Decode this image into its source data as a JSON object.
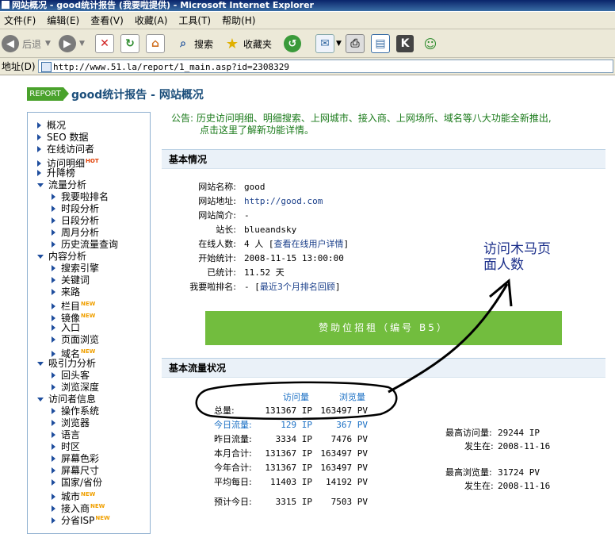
{
  "window": {
    "title": "网站概况 - good统计报告 (我要啦提供) - Microsoft Internet Explorer"
  },
  "menu": [
    "文件(F)",
    "编辑(E)",
    "查看(V)",
    "收藏(A)",
    "工具(T)",
    "帮助(H)"
  ],
  "toolbar": {
    "back_label": "后退",
    "search_label": "搜索",
    "favorites_label": "收藏夹"
  },
  "address": {
    "label": "地址(D)",
    "url": "http://www.51.la/report/1_main.asp?id=2308329"
  },
  "header": {
    "badge": "REPORT",
    "title": "good统计报告 - 网站概况"
  },
  "sidebar": {
    "items": [
      {
        "label": "概况",
        "level": 0,
        "arrow": "right"
      },
      {
        "label": "SEO 数据",
        "level": 0,
        "arrow": "right"
      },
      {
        "label": "在线访问者",
        "level": 0,
        "arrow": "right"
      },
      {
        "label": "访问明细",
        "level": 0,
        "arrow": "right",
        "badge": "HOT"
      },
      {
        "label": "升降榜",
        "level": 0,
        "arrow": "right"
      },
      {
        "label": "流量分析",
        "level": 0,
        "arrow": "down"
      },
      {
        "label": "我要啦排名",
        "level": 1,
        "arrow": "right"
      },
      {
        "label": "时段分析",
        "level": 1,
        "arrow": "right"
      },
      {
        "label": "日段分析",
        "level": 1,
        "arrow": "right"
      },
      {
        "label": "周月分析",
        "level": 1,
        "arrow": "right"
      },
      {
        "label": "历史流量查询",
        "level": 1,
        "arrow": "right"
      },
      {
        "label": "内容分析",
        "level": 0,
        "arrow": "down"
      },
      {
        "label": "搜索引擎",
        "level": 1,
        "arrow": "right"
      },
      {
        "label": "关键词",
        "level": 1,
        "arrow": "right"
      },
      {
        "label": "来路",
        "level": 1,
        "arrow": "right"
      },
      {
        "label": "栏目",
        "level": 1,
        "arrow": "right",
        "badge": "NEW"
      },
      {
        "label": "镜像",
        "level": 1,
        "arrow": "right",
        "badge": "NEW"
      },
      {
        "label": "入口",
        "level": 1,
        "arrow": "right"
      },
      {
        "label": "页面浏览",
        "level": 1,
        "arrow": "right"
      },
      {
        "label": "域名",
        "level": 1,
        "arrow": "right",
        "badge": "NEW"
      },
      {
        "label": "吸引力分析",
        "level": 0,
        "arrow": "down"
      },
      {
        "label": "回头客",
        "level": 1,
        "arrow": "right"
      },
      {
        "label": "浏览深度",
        "level": 1,
        "arrow": "right"
      },
      {
        "label": "访问者信息",
        "level": 0,
        "arrow": "down"
      },
      {
        "label": "操作系统",
        "level": 1,
        "arrow": "right"
      },
      {
        "label": "浏览器",
        "level": 1,
        "arrow": "right"
      },
      {
        "label": "语言",
        "level": 1,
        "arrow": "right"
      },
      {
        "label": "时区",
        "level": 1,
        "arrow": "right"
      },
      {
        "label": "屏幕色彩",
        "level": 1,
        "arrow": "right"
      },
      {
        "label": "屏幕尺寸",
        "level": 1,
        "arrow": "right"
      },
      {
        "label": "国家/省份",
        "level": 1,
        "arrow": "right"
      },
      {
        "label": "城市",
        "level": 1,
        "arrow": "right",
        "badge": "NEW"
      },
      {
        "label": "接入商",
        "level": 1,
        "arrow": "right",
        "badge": "NEW"
      },
      {
        "label": "分省ISP",
        "level": 1,
        "arrow": "right",
        "badge": "NEW"
      }
    ]
  },
  "notice": {
    "line1": "公告: 历史访问明细、明细搜索、上网城市、接入商、上网场所、域名等八大功能全新推出,",
    "line2": "点击这里了解新功能详情。"
  },
  "basic": {
    "header": "基本情况",
    "rows": [
      {
        "key": "网站名称:",
        "value": "good"
      },
      {
        "key": "网站地址:",
        "value": "http://good.com"
      },
      {
        "key": "网站简介:",
        "value": "-"
      },
      {
        "key": "站长:",
        "value": "blueandsky"
      },
      {
        "key": "在线人数:",
        "value": "4 人 [",
        "link": "查看在线用户详情",
        "suffix": "]"
      },
      {
        "key": "开始统计:",
        "value": "2008-11-15 13:00:00"
      },
      {
        "key": "已统计:",
        "value": "11.52 天"
      },
      {
        "key": "我要啦排名:",
        "value": "- [",
        "link": "最近3个月排名回顾",
        "suffix": "]"
      }
    ]
  },
  "sponsor": "赞助位招租（编号 B5）",
  "annotation": {
    "line1": "访问木马页",
    "line2": "面人数"
  },
  "traffic": {
    "header": "基本流量状况",
    "col_visits": "访问量",
    "col_views": "浏览量",
    "rows": [
      {
        "label": "总量:",
        "visits": "131367 IP",
        "views": "163497 PV"
      },
      {
        "label": "今日流量:",
        "visits": "129 IP",
        "views": "367 PV",
        "highlight": true
      },
      {
        "label": "昨日流量:",
        "visits": "3334 IP",
        "views": "7476 PV"
      },
      {
        "label": "本月合计:",
        "visits": "131367 IP",
        "views": "163497 PV"
      },
      {
        "label": "今年合计:",
        "visits": "131367 IP",
        "views": "163497 PV"
      },
      {
        "label": "平均每日:",
        "visits": "11403 IP",
        "views": "14192 PV"
      },
      {
        "label": "预计今日:",
        "visits": "3315 IP",
        "views": "7503 PV"
      }
    ],
    "max_visits_label": "最高访问量:",
    "max_visits": "29244 IP",
    "max_visits_date_label": "发生在:",
    "max_visits_date": "2008-11-16",
    "max_views_label": "最高浏览量:",
    "max_views": "31724 PV",
    "max_views_date_label": "发生在:",
    "max_views_date": "2008-11-16"
  }
}
